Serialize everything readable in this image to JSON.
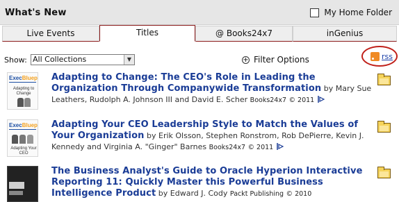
{
  "header": {
    "title": "What's New",
    "home_folder_label": "My Home Folder"
  },
  "tabs": [
    {
      "label": "Live Events",
      "active": false
    },
    {
      "label": "Titles",
      "active": true
    },
    {
      "label": "@ Books24x7",
      "active": false
    },
    {
      "label": "inGenius",
      "active": false
    }
  ],
  "toolbar": {
    "show_label": "Show:",
    "collection_selected": "All Collections",
    "filter_label": "Filter Options",
    "rss_label": "rss"
  },
  "items": [
    {
      "title": "Adapting to Change: The CEO's Role in Leading the Organization Through Companywide Transformation",
      "by": "by Mary Sue Leathers, Rudolph A. Johnson III and David E. Scher",
      "publisher": "Books24x7",
      "year": "© 2011",
      "cover": {
        "brand1": "Exec",
        "brand2": "Blueprints",
        "caption": "Adapting to Change"
      }
    },
    {
      "title": "Adapting Your CEO Leadership Style to Match the Values of Your Organization",
      "by": "by Erik Olsson, Stephen Ronstrom, Rob DePierre, Kevin J. Kennedy and Virginia A. \"Ginger\" Barnes",
      "publisher": "Books24x7",
      "year": "© 2011",
      "cover": {
        "brand1": "Exec",
        "brand2": "Blueprints",
        "caption": "Adapting Your CEO Leadership Style"
      }
    },
    {
      "title": "The Business Analyst's Guide to Oracle Hyperion Interactive Reporting 11: Quickly Master this Powerful Business Intelligence Product",
      "by": "by Edward J. Cody",
      "publisher": "Packt Publishing",
      "year": "© 2010",
      "cover": {
        "brand1": "",
        "brand2": "",
        "caption": ""
      }
    }
  ],
  "colors": {
    "accent_tab_border": "#8b1a1a",
    "title_link": "#1a3c96",
    "rss_highlight": "#c0201a",
    "rss_feed_icon": "#f08a24"
  }
}
